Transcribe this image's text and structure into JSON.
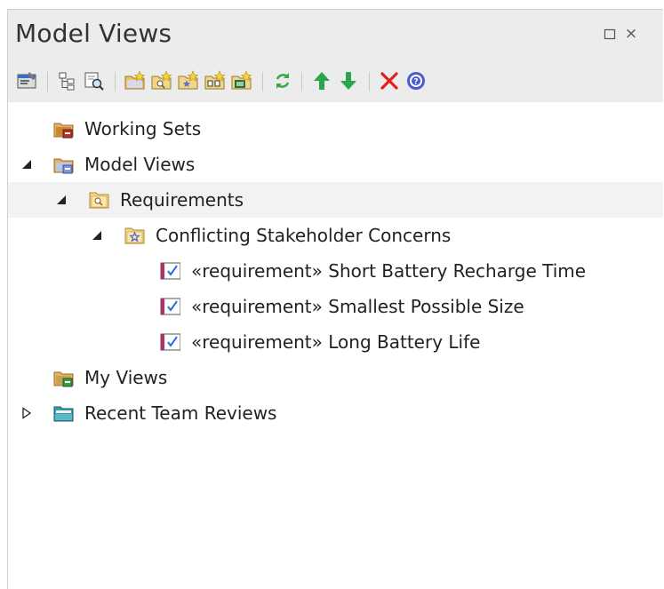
{
  "window": {
    "title": "Model Views",
    "restore_icon": "restore-window-icon",
    "close_icon": "close-icon",
    "close_glyph": "×"
  },
  "toolbar": {
    "items": [
      {
        "icon": "properties-icon"
      },
      {
        "icon": "expand-tree-icon"
      },
      {
        "icon": "find-element-icon"
      },
      {
        "icon": "new-view-icon"
      },
      {
        "icon": "new-search-view-icon"
      },
      {
        "icon": "new-favorites-view-icon"
      },
      {
        "icon": "new-diagram-view-icon"
      },
      {
        "icon": "new-slideshow-view-icon"
      },
      {
        "icon": "refresh-icon"
      },
      {
        "icon": "move-up-icon"
      },
      {
        "icon": "move-down-icon"
      },
      {
        "icon": "delete-icon"
      },
      {
        "icon": "help-icon"
      }
    ]
  },
  "tree": {
    "items": [
      {
        "label": "Working Sets",
        "icon": "working-sets-folder-icon",
        "expander": "none"
      },
      {
        "label": "Model Views",
        "icon": "model-views-folder-icon",
        "expander": "expanded"
      },
      {
        "label": "Requirements",
        "icon": "search-folder-icon",
        "expander": "expanded"
      },
      {
        "label": "Conflicting Stakeholder Concerns",
        "icon": "favorites-folder-icon",
        "expander": "expanded"
      },
      {
        "stereotype": "«requirement»",
        "label": "Short Battery Recharge Time",
        "icon": "requirement-icon"
      },
      {
        "stereotype": "«requirement»",
        "label": "Smallest Possible Size",
        "icon": "requirement-icon"
      },
      {
        "stereotype": "«requirement»",
        "label": "Long Battery Life",
        "icon": "requirement-icon"
      },
      {
        "label": "My Views",
        "icon": "my-views-folder-icon",
        "expander": "none"
      },
      {
        "label": "Recent Team Reviews",
        "icon": "team-reviews-folder-icon",
        "expander": "collapsed"
      }
    ]
  },
  "colors": {
    "titlebar_bg": "#ececec",
    "selected_row_bg": "#f2f2f2",
    "arrow_up": "#2aa54a",
    "arrow_down": "#2aa54a",
    "delete": "#e02020",
    "help": "#4a5bd6"
  }
}
